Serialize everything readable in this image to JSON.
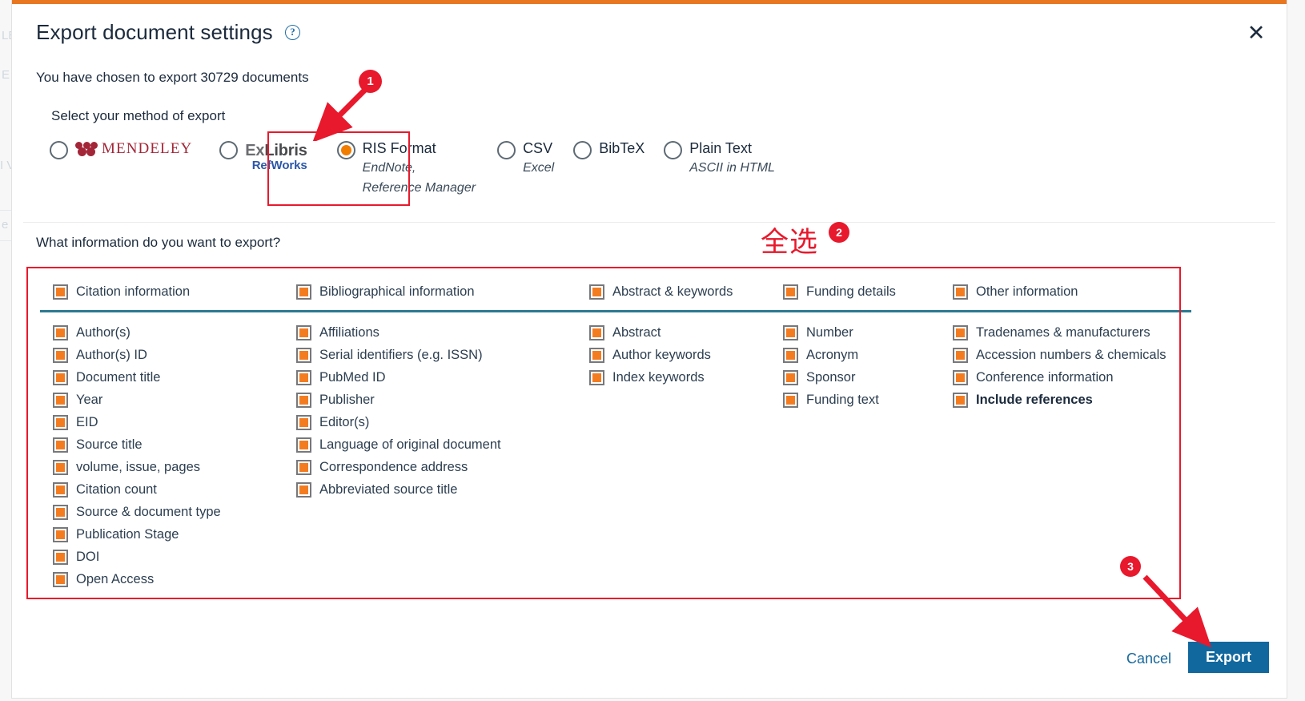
{
  "dialog": {
    "title": "Export document settings",
    "help_icon": "question-mark-circle-icon",
    "close_icon": "close-icon",
    "chosen_text": "You have chosen to export 30729 documents",
    "method_label": "Select your method of export",
    "info_question": "What information do you want to export?"
  },
  "accent_colors": {
    "orange_bar": "#e87722",
    "checkbox_orange": "#f47c20",
    "teal_rule": "#2b7a91",
    "annotation_red": "#e8192c",
    "export_blue": "#11689e",
    "link_blue": "#16689c"
  },
  "methods": [
    {
      "name": "MENDELEY",
      "sub": "",
      "type": "logo-mendeley",
      "checked": false
    },
    {
      "name": "ExLibris RefWorks",
      "sub": "",
      "type": "logo-exlibris",
      "checked": false,
      "top": "ExLibris",
      "bottom": "RefWorks"
    },
    {
      "name": "RIS Format",
      "sub": "EndNote,\nReference Manager",
      "sub_line1": "EndNote,",
      "sub_line2": "Reference Manager",
      "type": "text",
      "checked": true
    },
    {
      "name": "CSV",
      "sub": "Excel",
      "type": "text",
      "checked": false
    },
    {
      "name": "BibTeX",
      "sub": "",
      "type": "text",
      "checked": false
    },
    {
      "name": "Plain Text",
      "sub": "ASCII in HTML",
      "type": "text",
      "checked": false
    }
  ],
  "columns": [
    {
      "header": {
        "label": "Citation information",
        "checked": true
      },
      "items": [
        {
          "label": "Author(s)",
          "checked": true
        },
        {
          "label": "Author(s) ID",
          "checked": true
        },
        {
          "label": "Document title",
          "checked": true
        },
        {
          "label": "Year",
          "checked": true
        },
        {
          "label": "EID",
          "checked": true
        },
        {
          "label": "Source title",
          "checked": true
        },
        {
          "label": "volume, issue, pages",
          "checked": true
        },
        {
          "label": "Citation count",
          "checked": true
        },
        {
          "label": "Source & document type",
          "checked": true
        },
        {
          "label": "Publication Stage",
          "checked": true
        },
        {
          "label": "DOI",
          "checked": true
        },
        {
          "label": "Open Access",
          "checked": true
        }
      ]
    },
    {
      "header": {
        "label": "Bibliographical information",
        "checked": true
      },
      "items": [
        {
          "label": "Affiliations",
          "checked": true
        },
        {
          "label": "Serial identifiers (e.g. ISSN)",
          "checked": true
        },
        {
          "label": "PubMed ID",
          "checked": true
        },
        {
          "label": "Publisher",
          "checked": true
        },
        {
          "label": "Editor(s)",
          "checked": true
        },
        {
          "label": "Language of original document",
          "checked": true
        },
        {
          "label": "Correspondence address",
          "checked": true
        },
        {
          "label": "Abbreviated source title",
          "checked": true
        }
      ]
    },
    {
      "header": {
        "label": "Abstract & keywords",
        "checked": true
      },
      "items": [
        {
          "label": "Abstract",
          "checked": true
        },
        {
          "label": "Author keywords",
          "checked": true
        },
        {
          "label": "Index keywords",
          "checked": true
        }
      ]
    },
    {
      "header": {
        "label": "Funding details",
        "checked": true
      },
      "items": [
        {
          "label": "Number",
          "checked": true
        },
        {
          "label": "Acronym",
          "checked": true
        },
        {
          "label": "Sponsor",
          "checked": true
        },
        {
          "label": "Funding text",
          "checked": true
        }
      ]
    },
    {
      "header": {
        "label": "Other information",
        "checked": true
      },
      "items": [
        {
          "label": "Tradenames & manufacturers",
          "checked": true
        },
        {
          "label": "Accession numbers & chemicals",
          "checked": true
        },
        {
          "label": "Conference information",
          "checked": true
        },
        {
          "label": "Include references",
          "checked": true,
          "bold": true
        }
      ]
    }
  ],
  "footer": {
    "cancel_label": "Cancel",
    "export_label": "Export"
  },
  "annotations": {
    "badge_1": "1",
    "badge_2": "2",
    "badge_3": "3",
    "chinese_note": "全选"
  },
  "background_page": {
    "ghosts": [
      "LE",
      "E",
      "I V",
      "e"
    ]
  }
}
